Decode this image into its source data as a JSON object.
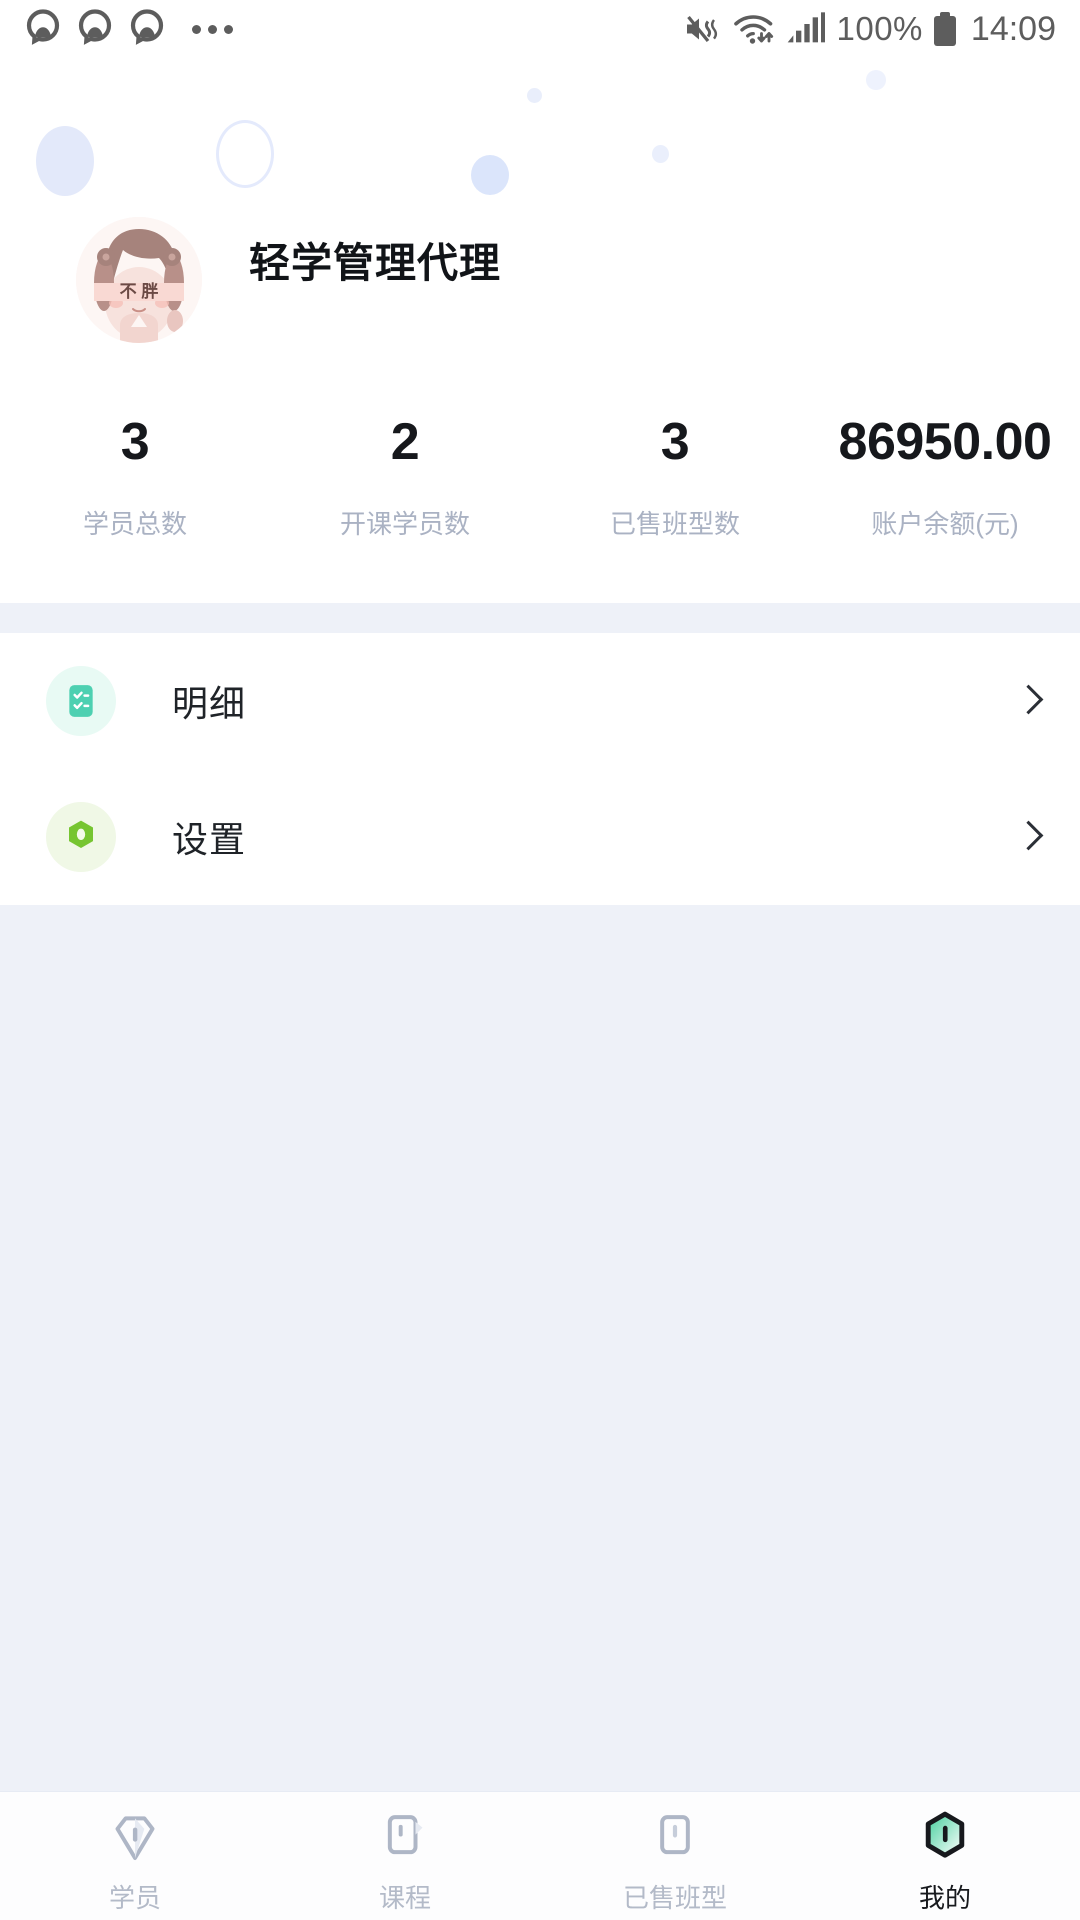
{
  "statusbar": {
    "battery_percent": "100%",
    "time": "14:09",
    "icons": [
      "qq-icon",
      "qq-icon",
      "qq-icon",
      "overflow-dots-icon",
      "mute-vibrate-icon",
      "wifi-icon",
      "signal-bars-icon",
      "battery-icon"
    ]
  },
  "header": {
    "username": "轻学管理代理",
    "avatar_caption": "不胖!"
  },
  "stats": [
    {
      "value": "3",
      "label": "学员总数"
    },
    {
      "value": "2",
      "label": "开课学员数"
    },
    {
      "value": "3",
      "label": "已售班型数"
    },
    {
      "value": "86950.00",
      "label": "账户余额(元)"
    }
  ],
  "menu": [
    {
      "label": "明细",
      "icon": "checklist-icon",
      "icon_bg": "#e8faf4",
      "icon_color": "#4dd0b1"
    },
    {
      "label": "设置",
      "icon": "gear-hex-icon",
      "icon_bg": "#f0f8e6",
      "icon_color": "#76c531"
    }
  ],
  "tabs": [
    {
      "label": "学员",
      "icon": "student-badge-icon",
      "active": false
    },
    {
      "label": "课程",
      "icon": "course-book-icon",
      "active": false
    },
    {
      "label": "已售班型",
      "icon": "sold-class-icon",
      "active": false
    },
    {
      "label": "我的",
      "icon": "profile-hex-icon",
      "active": true
    }
  ],
  "colors": {
    "page_bg": "#eef1f8",
    "card_bg": "#ffffff",
    "header_bg": "#f4f5fa",
    "text_primary": "#16181c",
    "text_muted": "#aab2c3",
    "accent_green": "#76c531",
    "accent_teal": "#4dd0b1"
  }
}
